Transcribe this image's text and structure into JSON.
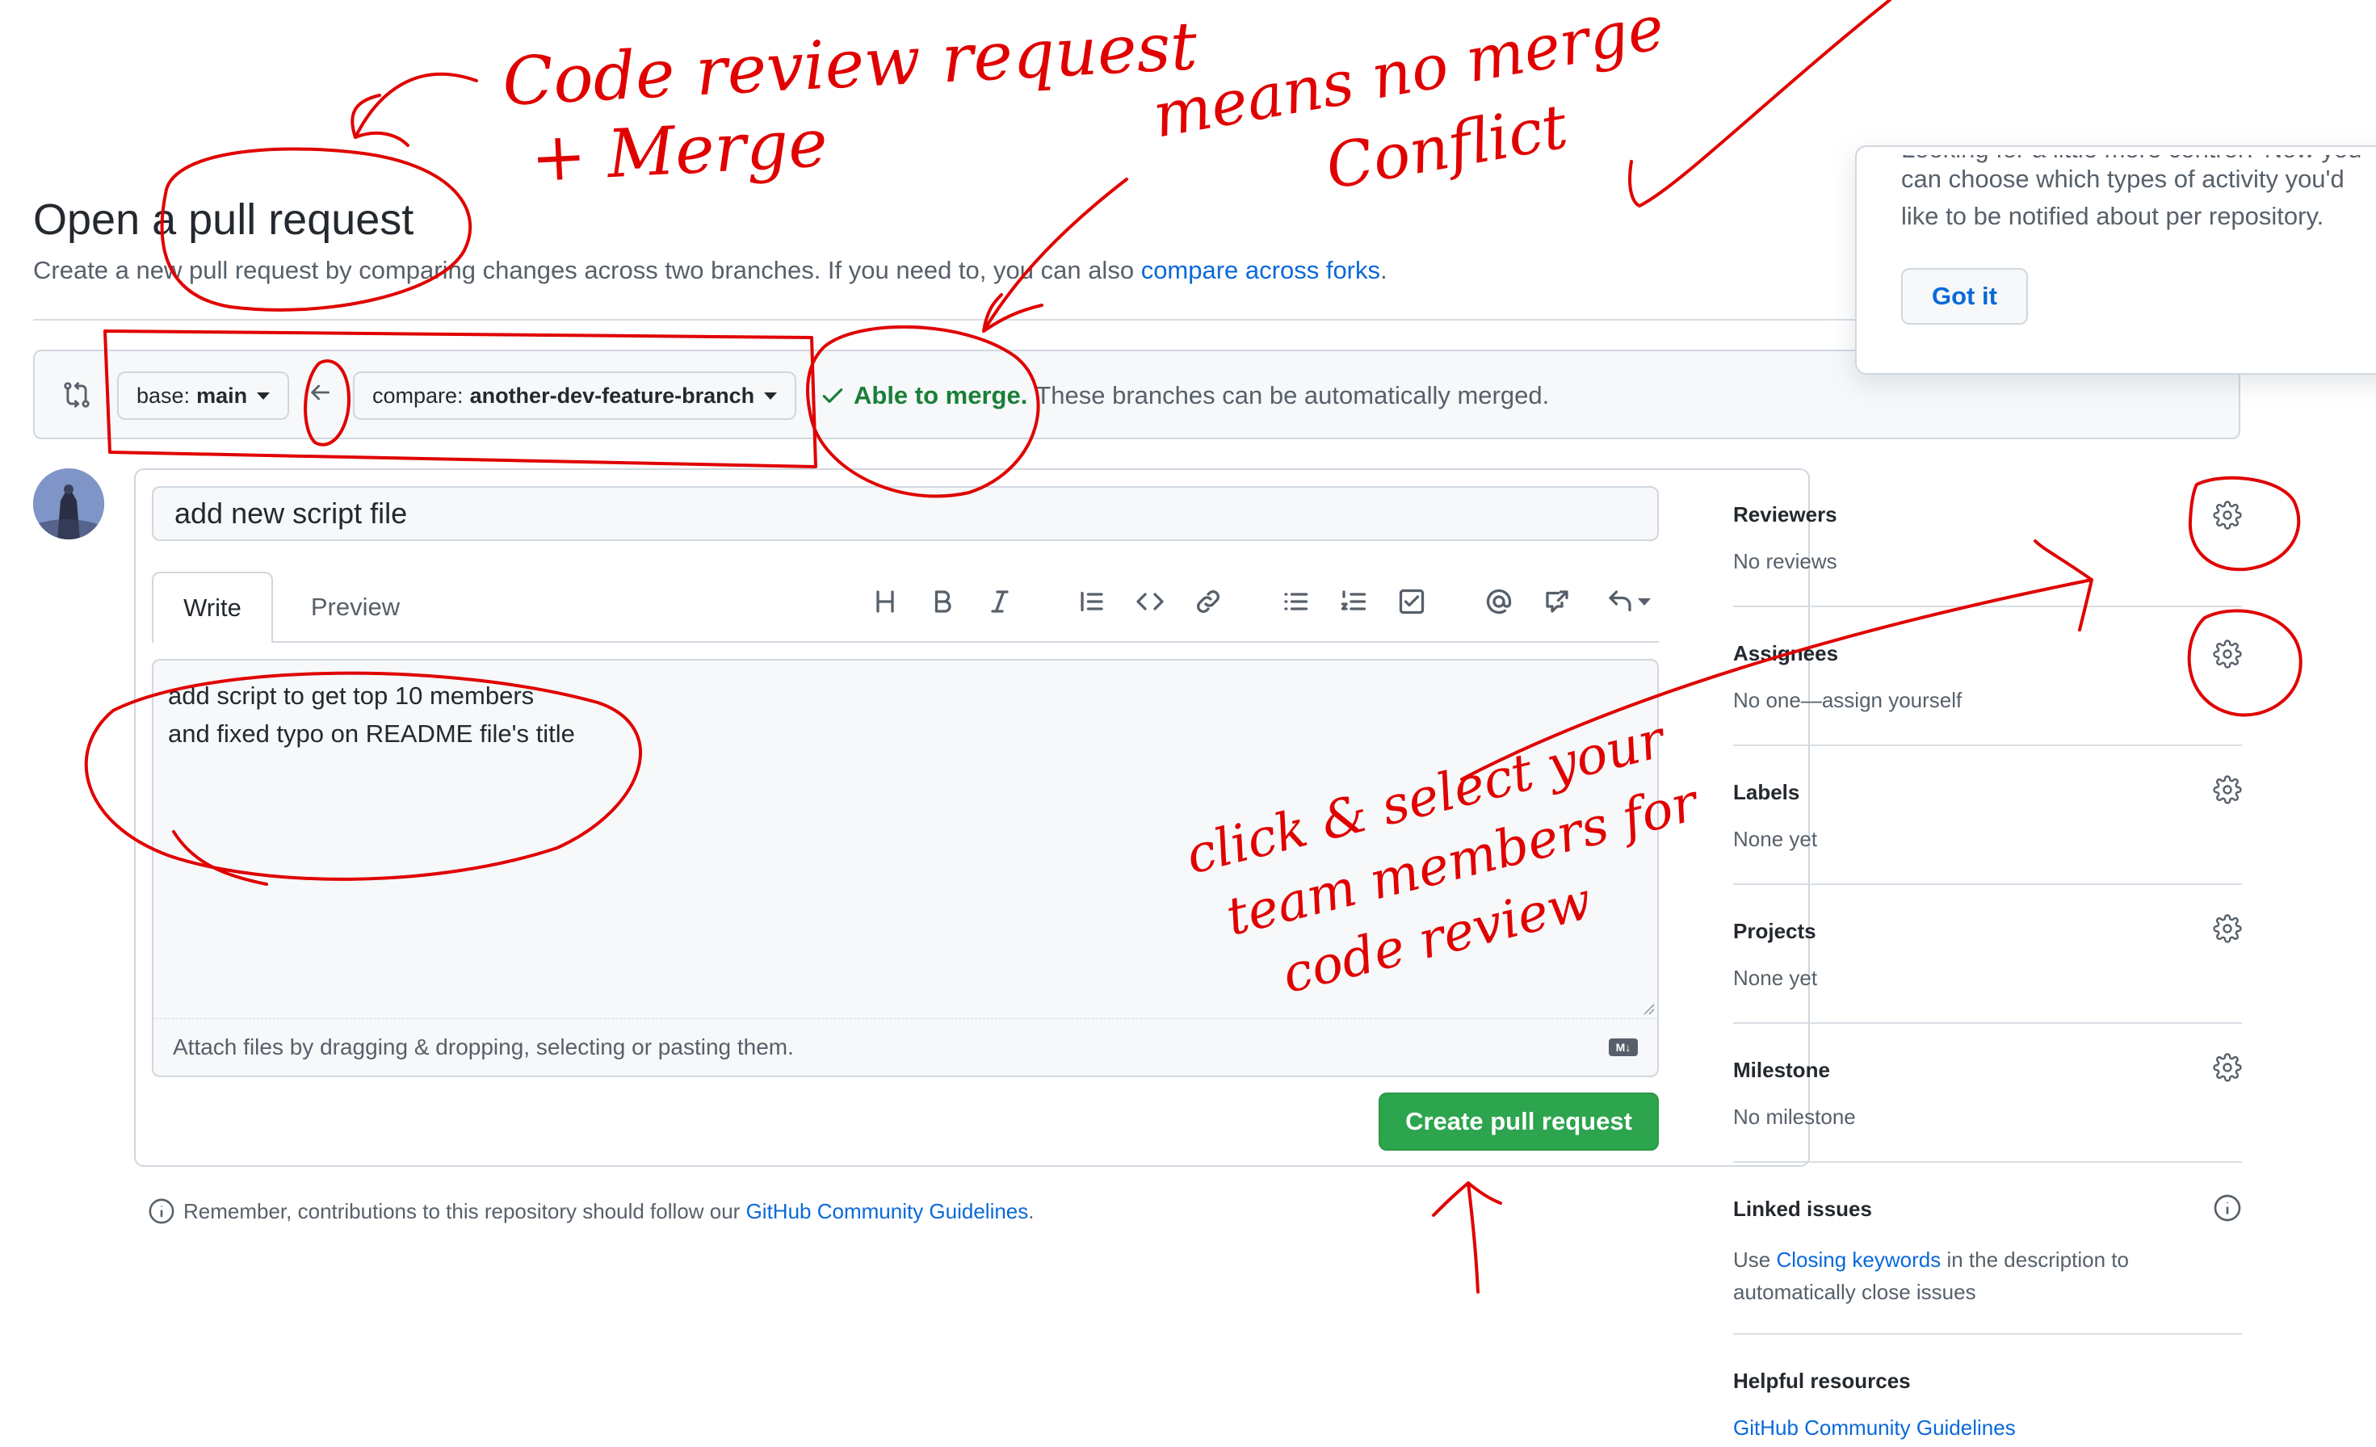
{
  "header": {
    "title": "Open a pull request",
    "subtitle": "Create a new pull request by comparing changes across two branches. If you need to, you can also",
    "subtitle_link": "compare across forks",
    "subtitle_end": "."
  },
  "compare": {
    "base_prefix": "base:",
    "base_branch": "main",
    "compare_prefix": "compare:",
    "compare_branch": "another-dev-feature-branch",
    "merge_status": "Able to merge.",
    "merge_message": "These branches can be automatically merged."
  },
  "popover": {
    "text_line1": "Looking for a little more control? Now you",
    "text_line2": "can choose which types of activity you'd",
    "text_line3": "like to be notified about per repository.",
    "button": "Got it"
  },
  "form": {
    "title_value": "add new script file",
    "tab_write": "Write",
    "tab_preview": "Preview",
    "body_line1": "add script to get top 10 members",
    "body_line2": "and fixed typo on README file's title",
    "attach_hint": "Attach files by dragging & dropping, selecting or pasting them.",
    "submit": "Create pull request",
    "toolbar_icons": [
      "heading-icon",
      "bold-icon",
      "italic-icon",
      "quote-icon",
      "code-icon",
      "link-icon",
      "unordered-list-icon",
      "ordered-list-icon",
      "task-list-icon",
      "mention-icon",
      "cross-reference-icon",
      "reply-icon"
    ]
  },
  "remember": {
    "text": "Remember, contributions to this repository should follow our",
    "link": "GitHub Community Guidelines",
    "end": "."
  },
  "sidebar": {
    "reviewers": {
      "label": "Reviewers",
      "value": "No reviews"
    },
    "assignees": {
      "label": "Assignees",
      "value": "No one—assign yourself"
    },
    "labels": {
      "label": "Labels",
      "value": "None yet"
    },
    "projects": {
      "label": "Projects",
      "value": "None yet"
    },
    "milestone": {
      "label": "Milestone",
      "value": "No milestone"
    },
    "linked_issues": {
      "label": "Linked issues",
      "value_pre": "Use",
      "value_link": "Closing keywords",
      "value_post": "in the description to",
      "value_line2": "automatically close issues"
    },
    "helpful": {
      "label": "Helpful resources",
      "link": "GitHub Community Guidelines"
    }
  },
  "annotations": {
    "note_title_line1": "Code review request",
    "note_title_line2": "+ Merge",
    "note_merge_line1": "means no merge",
    "note_merge_line2": "Conflict",
    "note_reviewers_line1": "click & select your",
    "note_reviewers_line2": "team members for",
    "note_reviewers_line3": "code review"
  },
  "colors": {
    "accent": "#0969da",
    "success": "#1a7f37",
    "button_green": "#2da44e",
    "annotation_red": "#e00000"
  }
}
